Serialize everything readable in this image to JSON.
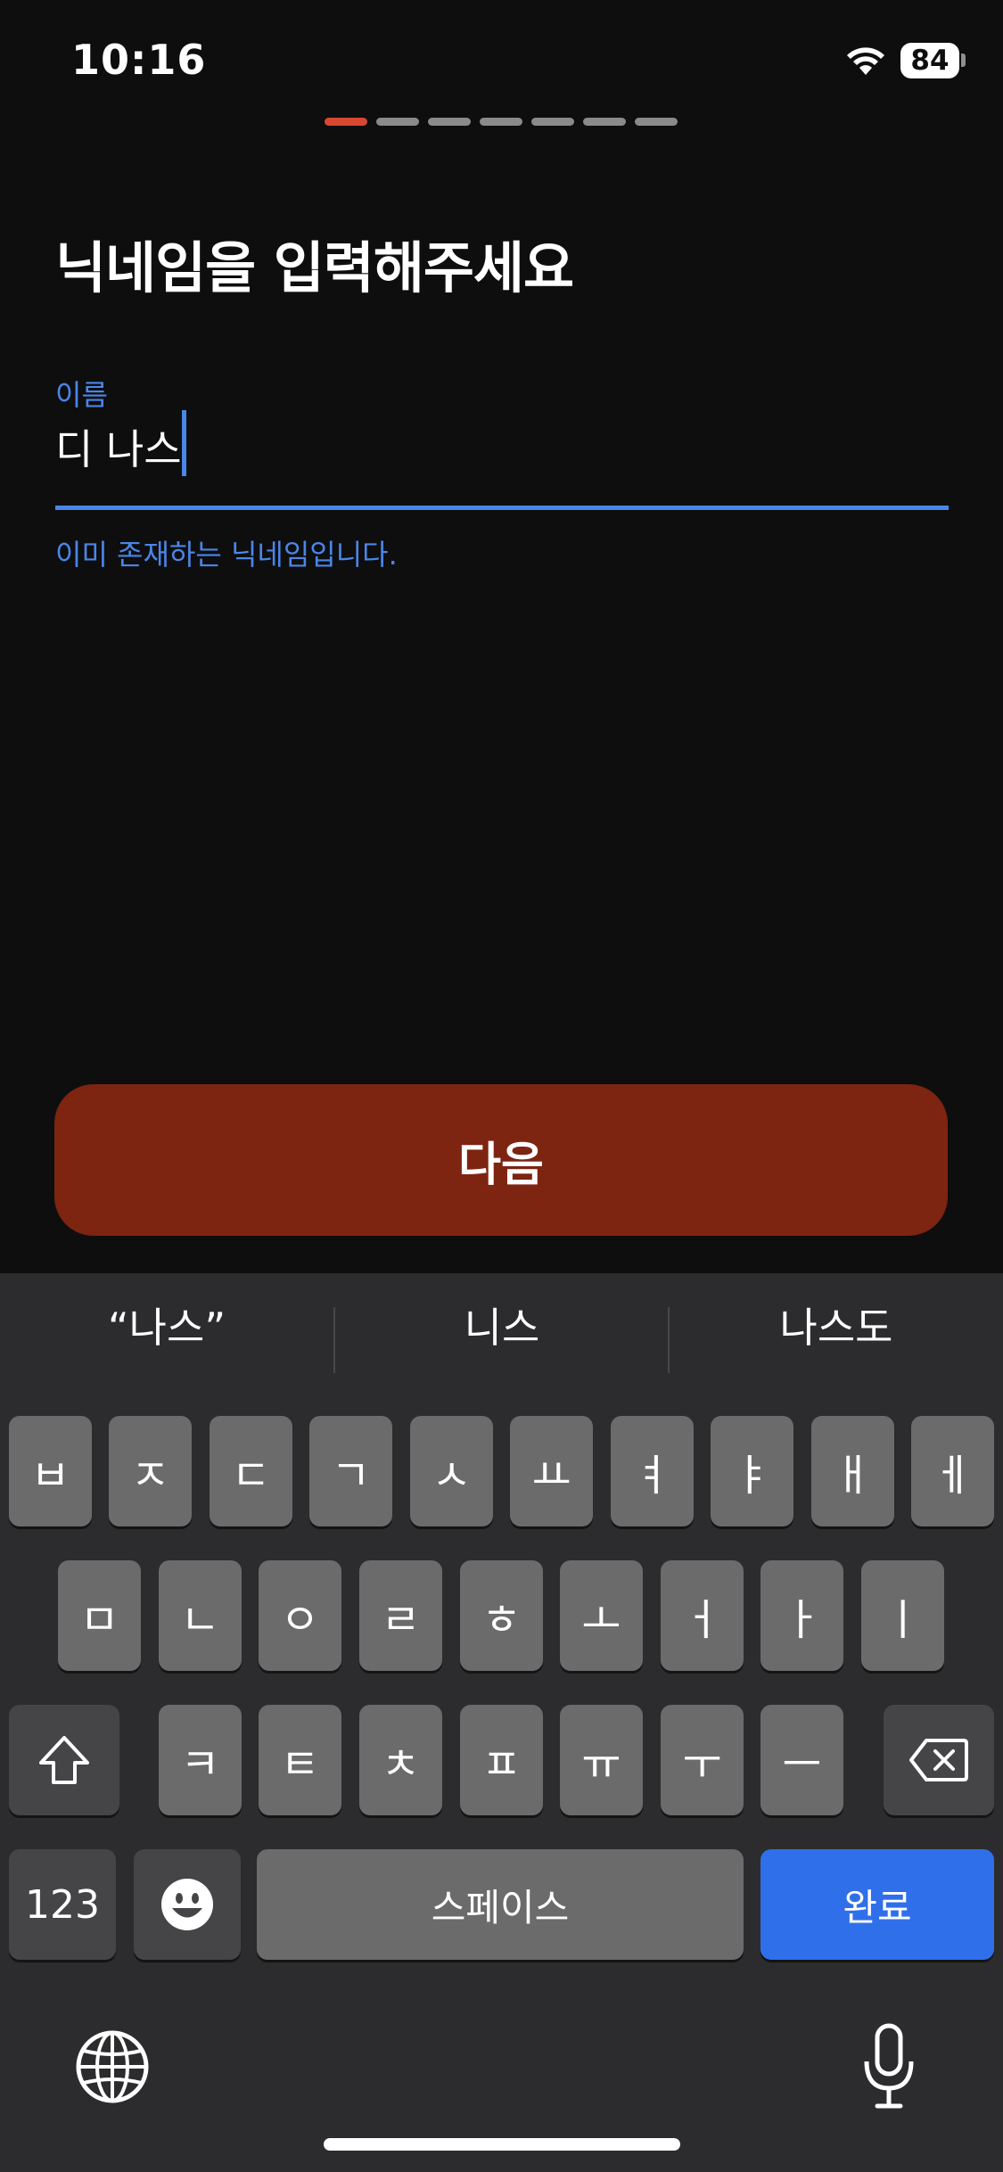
{
  "status": {
    "time": "10:16",
    "battery": "84"
  },
  "progress": {
    "total_steps": 7,
    "current_step": 1
  },
  "title": "닉네임을 입력해주세요",
  "field": {
    "label": "이름",
    "value": "디 나스",
    "error": "이미 존재하는 닉네임입니다."
  },
  "next_button": "다음",
  "keyboard": {
    "suggestions": [
      "“나스”",
      "니스",
      "나스도"
    ],
    "row1": [
      "ㅂ",
      "ㅈ",
      "ㄷ",
      "ㄱ",
      "ㅅ",
      "ㅛ",
      "ㅕ",
      "ㅑ",
      "ㅐ",
      "ㅔ"
    ],
    "row2": [
      "ㅁ",
      "ㄴ",
      "ㅇ",
      "ㄹ",
      "ㅎ",
      "ㅗ",
      "ㅓ",
      "ㅏ",
      "ㅣ"
    ],
    "row3": [
      "ㅋ",
      "ㅌ",
      "ㅊ",
      "ㅍ",
      "ㅠ",
      "ㅜ",
      "ㅡ"
    ],
    "numbers_key": "123",
    "space_key": "스페이스",
    "done_key": "완료"
  },
  "colors": {
    "accent": "#4a86e8",
    "brand": "#d8472f",
    "button": "#7d2511",
    "done_key": "#2f6fea"
  },
  "icons": [
    "wifi-icon",
    "battery-icon",
    "shift-icon",
    "backspace-icon",
    "emoji-icon",
    "globe-icon",
    "microphone-icon"
  ]
}
